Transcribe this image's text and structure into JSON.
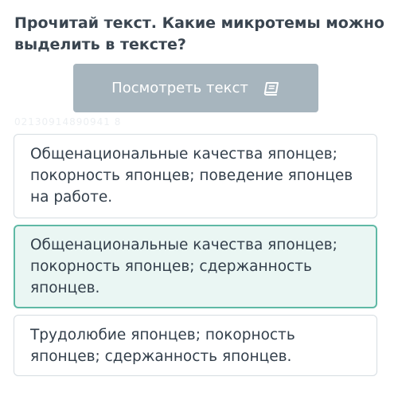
{
  "question": {
    "text": "Прочитай текст. Какие микротемы можно выделить в тексте?"
  },
  "view_button": {
    "label": "Посмотреть текст",
    "icon": "book-icon"
  },
  "watermark": {
    "text": "02130914890941 8"
  },
  "answers": [
    {
      "text": "Общенациональные качества японцев; покорность японцев; поведение японцев на работе.",
      "selected": false
    },
    {
      "text": "Общенациональные качества японцев; покорность японцев; сдержанность японцев.",
      "selected": true
    },
    {
      "text": "Трудолюбие японцев; покорность японцев; сдержанность японцев.",
      "selected": false
    }
  ],
  "colors": {
    "button_bg": "#a7b5be",
    "selected_border": "#5fb9a5",
    "selected_bg": "#eaf6f3",
    "text": "#333f4b"
  }
}
